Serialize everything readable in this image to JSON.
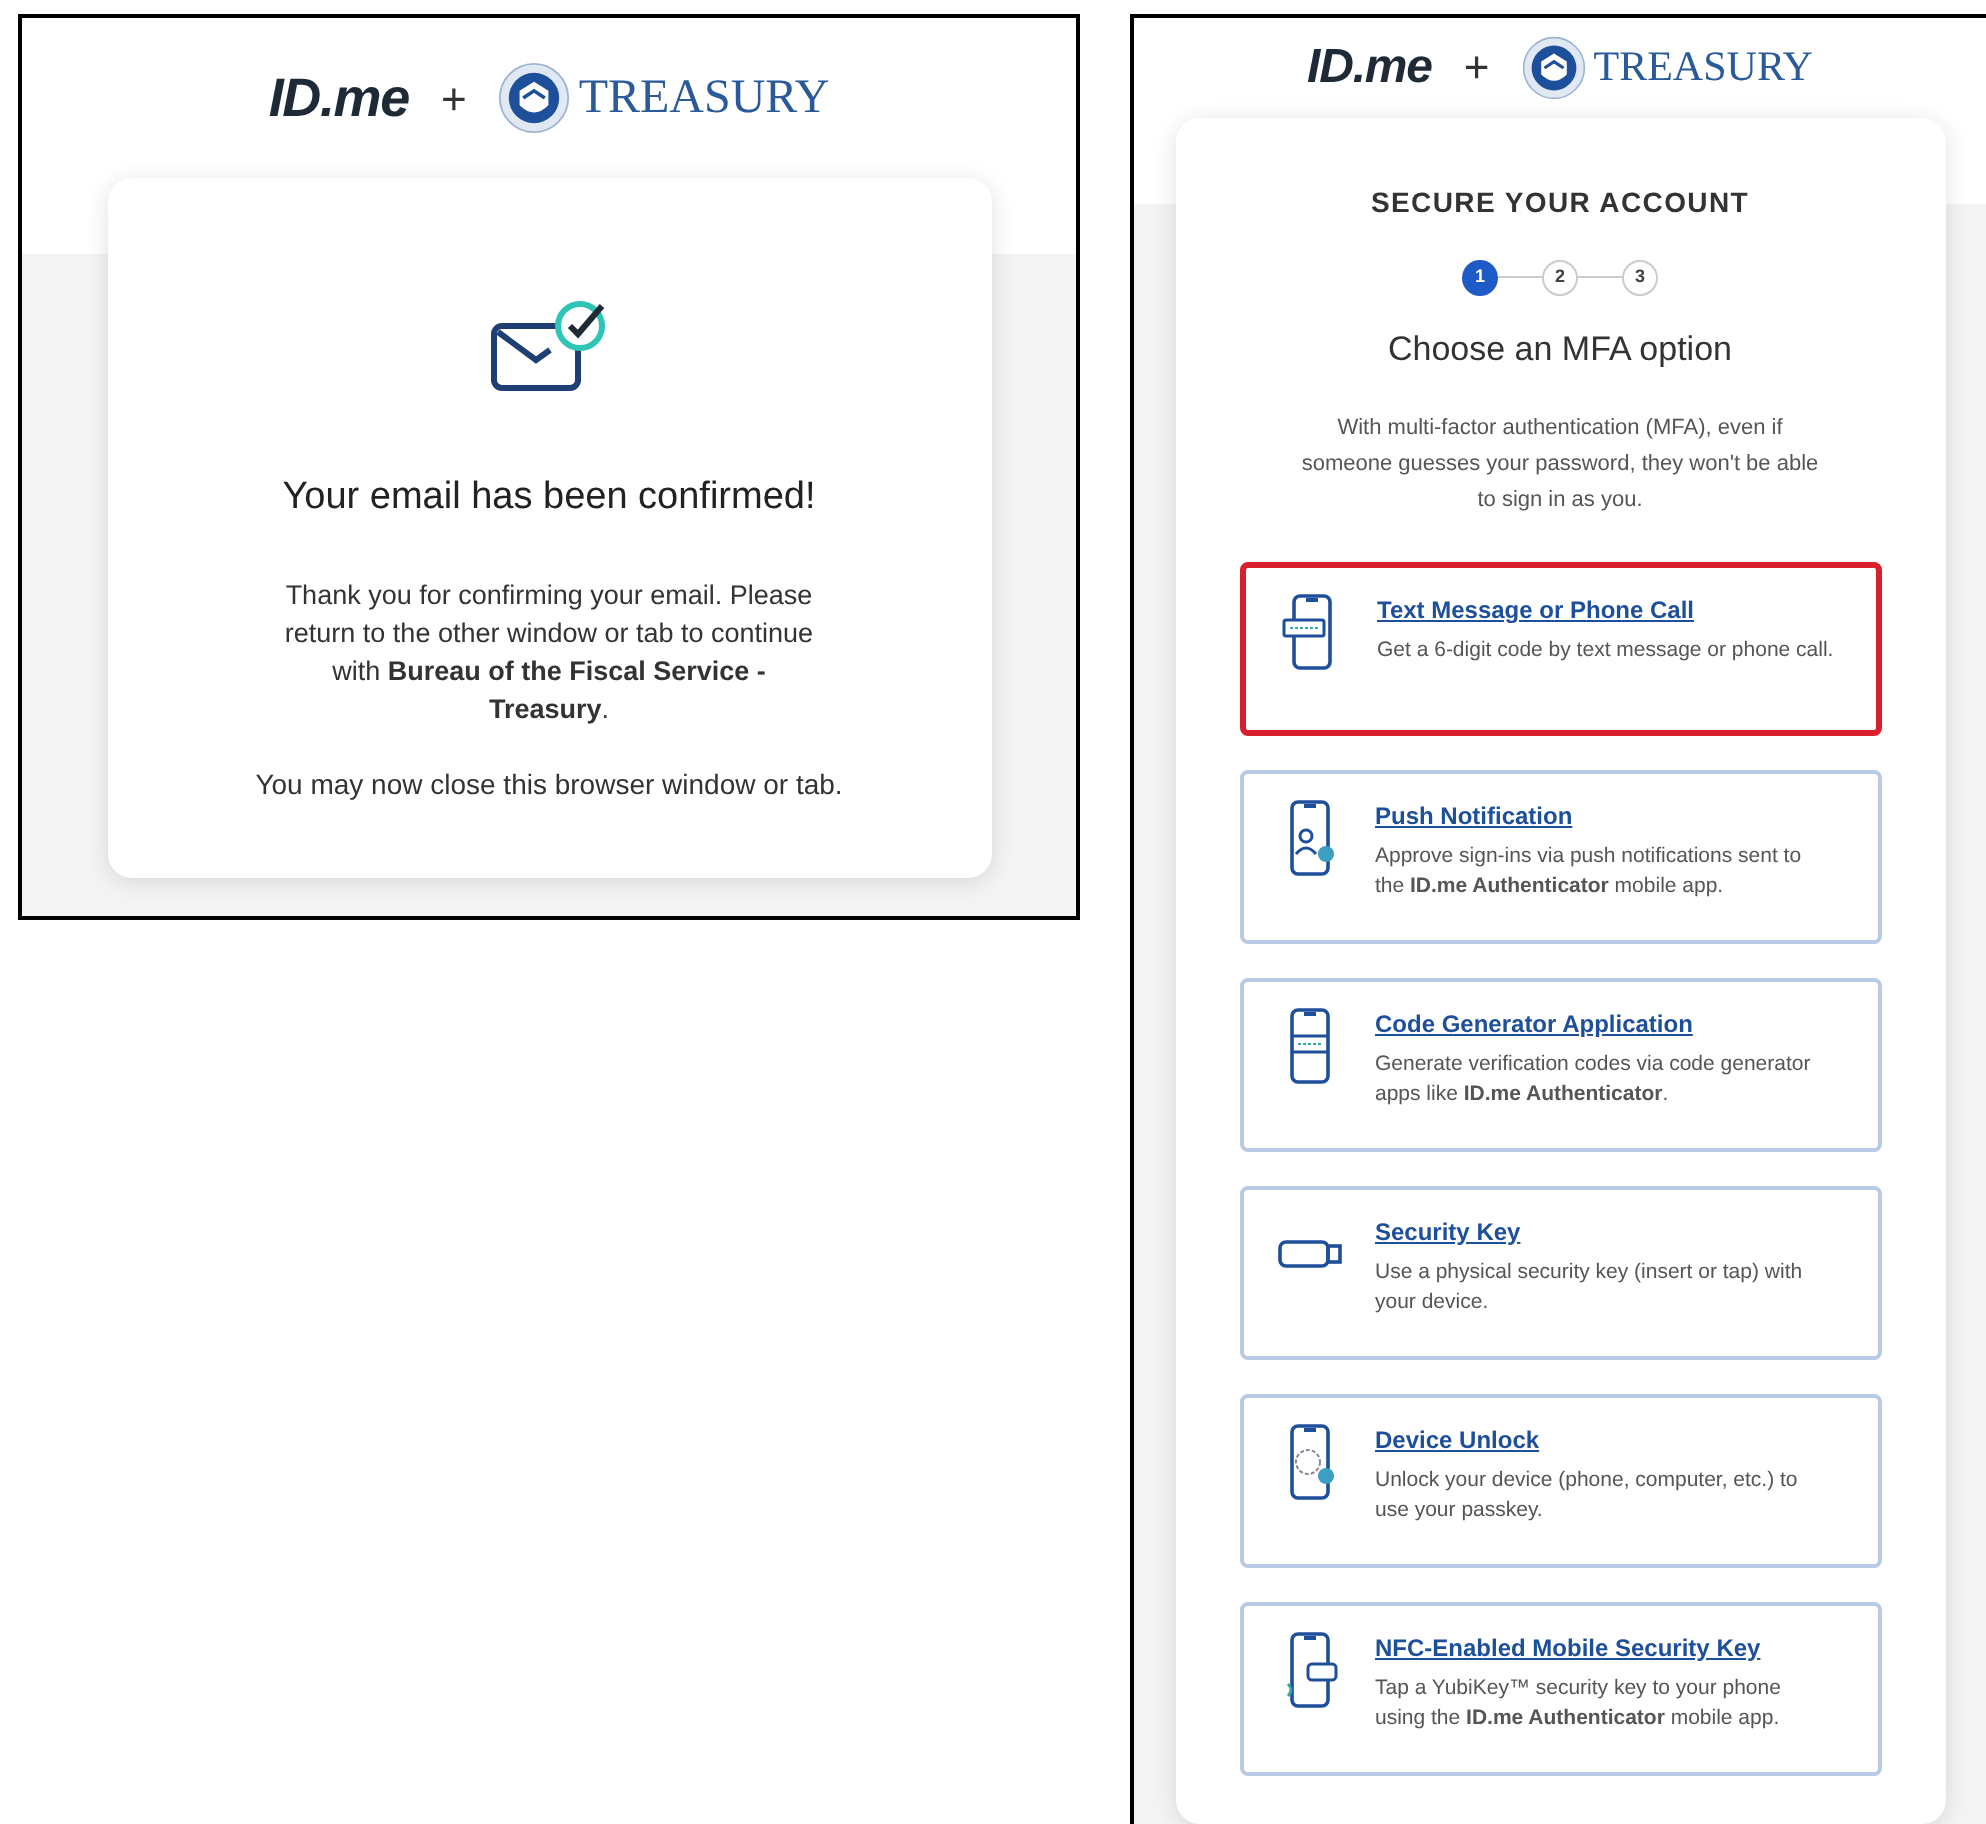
{
  "confirmation_page": {
    "logo_left": "ID.me",
    "plus": "+",
    "logo_right": "TREASURY",
    "title": "Your email has been confirmed!",
    "message": "Thank you for confirming your email. Please return to the other window or tab to continue with **Bureau of the Fiscal Service - Treasury**.",
    "note": "You may now close this browser window or tab."
  },
  "mfa_page": {
    "logo_left": "ID.me",
    "plus": "+",
    "logo_right": "TREASURY",
    "heading": "SECURE YOUR ACCOUNT",
    "steps": [
      {
        "label": "1",
        "selected": true
      },
      {
        "label": "2",
        "selected": false
      },
      {
        "label": "3",
        "selected": false
      }
    ],
    "title": "Choose an MFA option",
    "intro": "With multi-factor authentication (MFA), even if someone guesses your password, they won't be able to sign in as you.",
    "options": [
      {
        "kind": "phone-message",
        "title": "Text Message or Phone Call",
        "description": "Get a 6-digit code by text message or phone call.",
        "highlighted": true
      },
      {
        "kind": "phone-person",
        "title": "Push Notification",
        "description": "Approve sign-ins via push notifications sent to the **ID.me Authenticator** mobile app.",
        "highlighted": false
      },
      {
        "kind": "phone-code",
        "title": "Code Generator Application",
        "description": "Generate verification codes via code generator apps like **ID.me Authenticator**.",
        "highlighted": false
      },
      {
        "kind": "usb-key",
        "title": "Security Key",
        "description": "Use a physical security key (insert or tap) with your device.",
        "highlighted": false
      },
      {
        "kind": "phone-fingerprint",
        "title": "Device Unlock",
        "description": "Unlock your device (phone, computer, etc.) to use your passkey.",
        "highlighted": false
      },
      {
        "kind": "phone-nfc",
        "title": "NFC-Enabled Mobile Security Key",
        "description": "Tap a YubiKey™ security key to your phone using the **ID.me Authenticator** mobile app.",
        "highlighted": false
      }
    ]
  }
}
